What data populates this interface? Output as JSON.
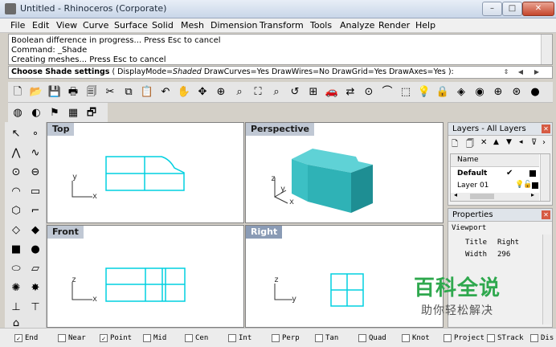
{
  "window": {
    "title": "Untitled - Rhinoceros (Corporate)",
    "min": "–",
    "max": "□",
    "close": "✕"
  },
  "menu": [
    "File",
    "Edit",
    "View",
    "Curve",
    "Surface",
    "Solid",
    "Mesh",
    "Dimension",
    "Transform",
    "Tools",
    "Analyze",
    "Render",
    "Help"
  ],
  "history": [
    "Boolean difference in progress... Press Esc to cancel",
    "Command: _Shade",
    "Creating meshes... Press Esc to cancel"
  ],
  "prompt": {
    "heading": "Choose Shade settings",
    "open": " ( ",
    "dm_key": "DisplayMode=",
    "dm_val": "Shaded",
    "dc": " DrawCurves=Yes",
    "dw": " DrawWires=No",
    "dg": " DrawGrid=Yes",
    "da": " DrawAxes=Yes",
    "close": " ):"
  },
  "viewports": {
    "top": {
      "label": "Top",
      "axis_y": "y",
      "axis_x": "x"
    },
    "perspective": {
      "label": "Perspective",
      "axis_z": "z",
      "axis_y": "y",
      "axis_x": "x"
    },
    "front": {
      "label": "Front",
      "axis_z": "z",
      "axis_x": "x"
    },
    "right": {
      "label": "Right",
      "axis_z": "z",
      "axis_y": "y"
    }
  },
  "layers": {
    "title": "Layers - All Layers",
    "column": "Name",
    "rows": [
      {
        "name": "Default",
        "check": "✔"
      },
      {
        "name": "Layer 01"
      }
    ]
  },
  "properties": {
    "title": "Properties",
    "section": "Viewport",
    "fields": [
      {
        "key": "Title",
        "value": "Right"
      },
      {
        "key": "Width",
        "value": "296"
      }
    ]
  },
  "osnap": [
    {
      "label": "End",
      "checked": true,
      "mark": "✓"
    },
    {
      "label": "Near",
      "checked": false
    },
    {
      "label": "Point",
      "checked": true,
      "mark": "✓"
    },
    {
      "label": "Mid",
      "checked": false
    },
    {
      "label": "Cen",
      "checked": false
    },
    {
      "label": "Int",
      "checked": false
    },
    {
      "label": "Perp",
      "checked": false
    },
    {
      "label": "Tan",
      "checked": false
    },
    {
      "label": "Quad",
      "checked": false
    },
    {
      "label": "Knot",
      "checked": false
    },
    {
      "label": "Project",
      "checked": false
    },
    {
      "label": "STrack",
      "checked": false
    },
    {
      "label": "Dis",
      "checked": false
    }
  ],
  "watermark": {
    "big": "百科全说",
    "small": "助你轻松解决"
  },
  "colors": {
    "wire": "#00d0e0",
    "solid": "#3cc0c4",
    "solid_dark": "#1e8e93",
    "active_label": "#8a9bb5"
  }
}
